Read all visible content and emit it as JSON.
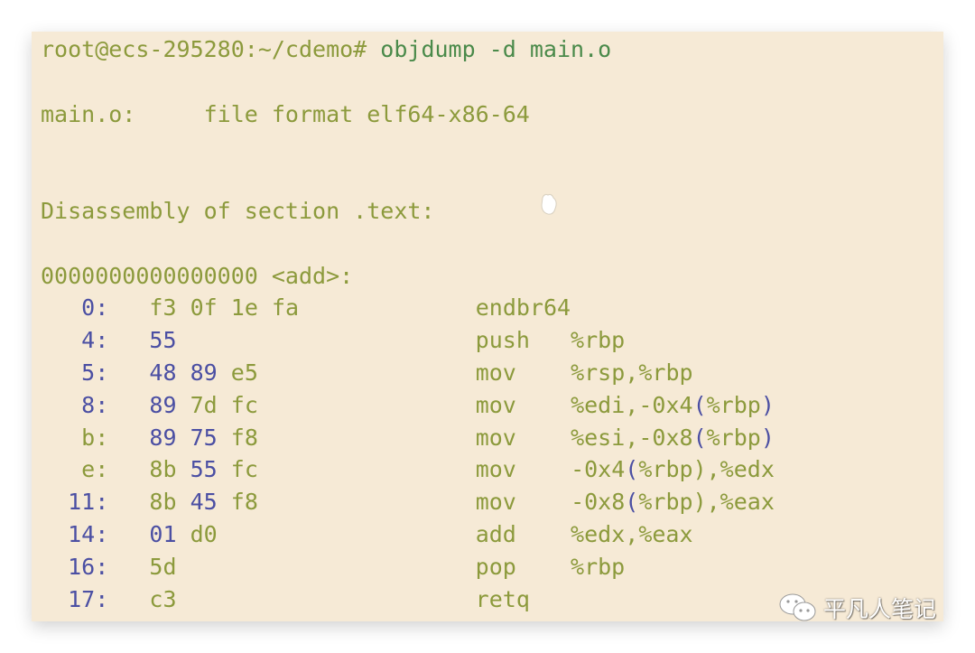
{
  "terminal": {
    "prompt": "root@ecs-295280:~/cdemo#",
    "command": "objdump -d main.o",
    "file_format_line": "main.o:     file format elf64-x86-64",
    "section_header": "Disassembly of section .text:",
    "symbol_header": "0000000000000000 <add>:",
    "rows": [
      {
        "addr": "0:",
        "bytes": "f3 0f 1e fa",
        "mnemonic": "endbr64",
        "operands": ""
      },
      {
        "addr": "4:",
        "bytes": "55",
        "mnemonic": "push",
        "operands": "%rbp"
      },
      {
        "addr": "5:",
        "bytes": "48 89 e5",
        "mnemonic": "mov",
        "operands": "%rsp,%rbp"
      },
      {
        "addr": "8:",
        "bytes": "89 7d fc",
        "mnemonic": "mov",
        "operands": "%edi,-0x4(%rbp)"
      },
      {
        "addr": "b:",
        "bytes": "89 75 f8",
        "mnemonic": "mov",
        "operands": "%esi,-0x8(%rbp)"
      },
      {
        "addr": "e:",
        "bytes": "8b 55 fc",
        "mnemonic": "mov",
        "operands": "-0x4(%rbp),%edx"
      },
      {
        "addr": "11:",
        "bytes": "8b 45 f8",
        "mnemonic": "mov",
        "operands": "-0x8(%rbp),%eax"
      },
      {
        "addr": "14:",
        "bytes": "01 d0",
        "mnemonic": "add",
        "operands": "%edx,%eax"
      },
      {
        "addr": "16:",
        "bytes": "5d",
        "mnemonic": "pop",
        "operands": "%rbp"
      },
      {
        "addr": "17:",
        "bytes": "c3",
        "mnemonic": "retq",
        "operands": ""
      }
    ]
  },
  "watermark": {
    "icon": "wechat-icon",
    "text": "平凡人笔记"
  },
  "colors": {
    "background": "#f6ead6",
    "text": "#8c9a3c",
    "number": "#4b4fa3",
    "command": "#4a8a4a"
  }
}
